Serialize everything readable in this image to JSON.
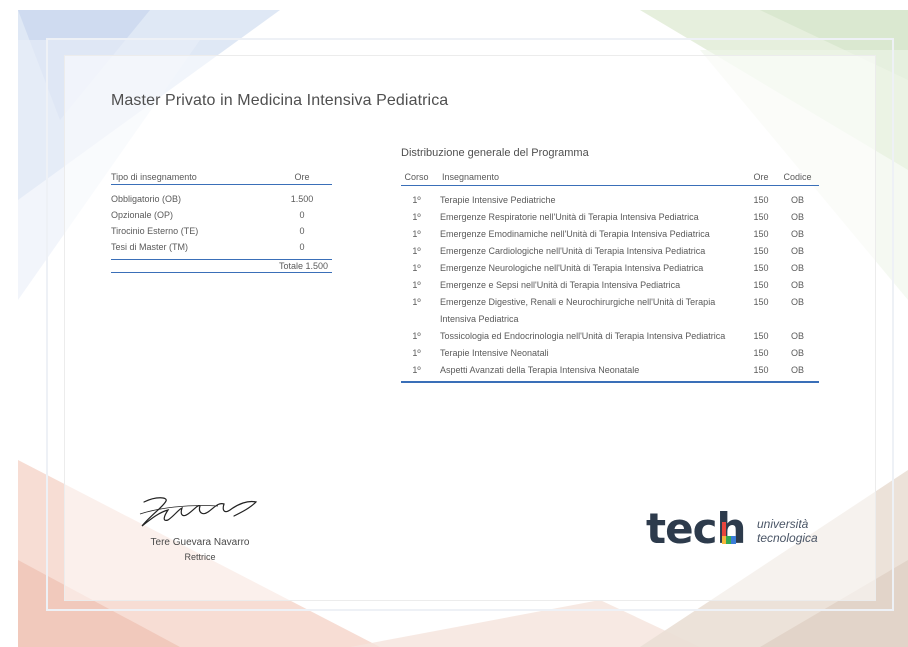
{
  "document": {
    "title": "Master Privato in Medicina Intensiva Pediatrica"
  },
  "summary_table": {
    "header_type": "Tipo di insegnamento",
    "header_hours": "Ore",
    "rows": [
      {
        "type": "Obbligatorio (OB)",
        "hours": "1.500"
      },
      {
        "type": "Opzionale (OP)",
        "hours": "0"
      },
      {
        "type": "Tirocinio Esterno (TE)",
        "hours": "0"
      },
      {
        "type": "Tesi di Master (TM)",
        "hours": "0"
      }
    ],
    "total": "Totale 1.500"
  },
  "program": {
    "title": "Distribuzione generale del Programma",
    "headers": {
      "course": "Corso",
      "subject": "Insegnamento",
      "hours": "Ore",
      "code": "Codice"
    },
    "rows": [
      {
        "course": "1º",
        "subject": "Terapie Intensive Pediatriche",
        "hours": "150",
        "code": "OB"
      },
      {
        "course": "1º",
        "subject": "Emergenze Respiratorie nell'Unità di Terapia Intensiva Pediatrica",
        "hours": "150",
        "code": "OB"
      },
      {
        "course": "1º",
        "subject": "Emergenze Emodinamiche nell'Unità di Terapia Intensiva Pediatrica",
        "hours": "150",
        "code": "OB"
      },
      {
        "course": "1º",
        "subject": "Emergenze Cardiologiche nell'Unità di Terapia Intensiva Pediatrica",
        "hours": "150",
        "code": "OB"
      },
      {
        "course": "1º",
        "subject": "Emergenze Neurologiche nell'Unità di Terapia Intensiva Pediatrica",
        "hours": "150",
        "code": "OB"
      },
      {
        "course": "1º",
        "subject": "Emergenze e Sepsi nell'Unità di Terapia Intensiva Pediatrica",
        "hours": "150",
        "code": "OB"
      },
      {
        "course": "1º",
        "subject": "Emergenze Digestive, Renali e Neurochirurgiche nell'Unità di Terapia Intensiva Pediatrica",
        "hours": "150",
        "code": "OB"
      },
      {
        "course": "1º",
        "subject": "Tossicologia ed Endocrinologia nell'Unità di Terapia Intensiva Pediatrica",
        "hours": "150",
        "code": "OB"
      },
      {
        "course": "1º",
        "subject": "Terapie Intensive Neonatali",
        "hours": "150",
        "code": "OB"
      },
      {
        "course": "1º",
        "subject": "Aspetti Avanzati della Terapia Intensiva Neonatale",
        "hours": "150",
        "code": "OB"
      }
    ]
  },
  "signatory": {
    "name": "Tere Guevara Navarro",
    "role": "Rettrice"
  },
  "logo": {
    "word": "tech",
    "sub_line1": "università",
    "sub_line2": "tecnologica"
  },
  "colors": {
    "accent_blue": "#3a6fb8",
    "logo_dark": "#2d3b4c"
  }
}
